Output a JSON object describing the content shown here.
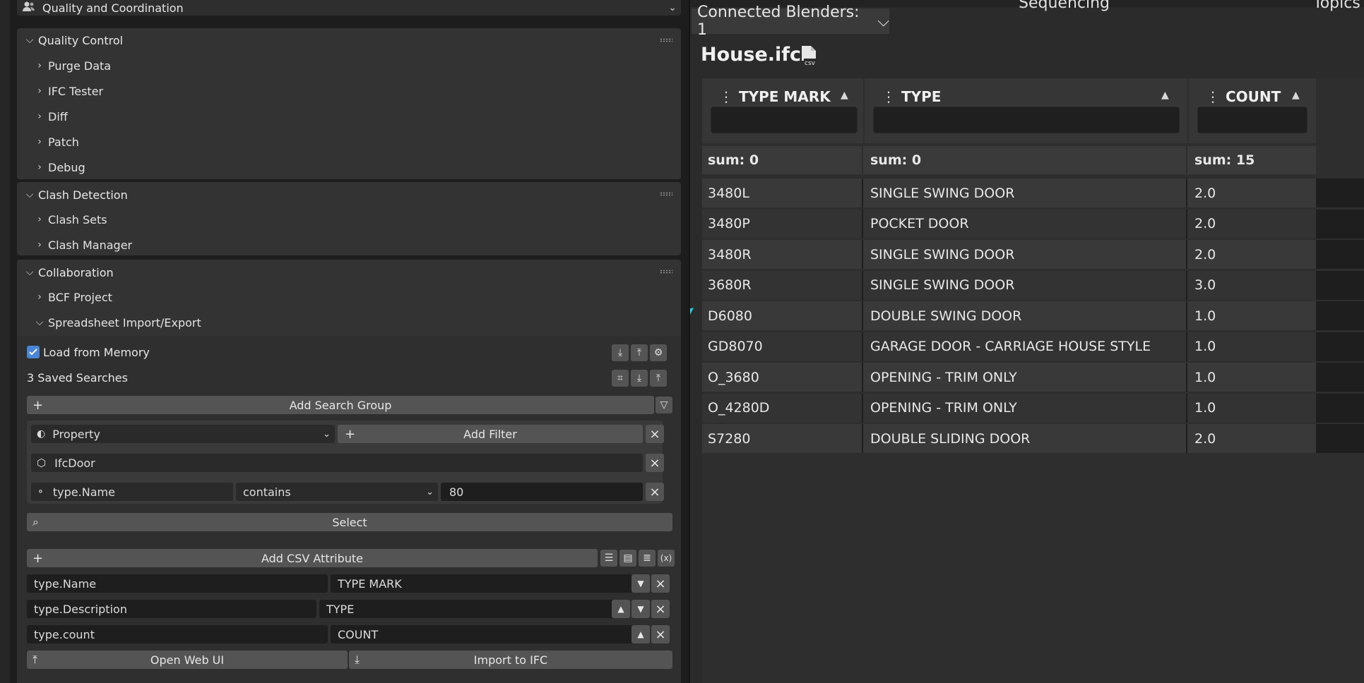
{
  "colors": {
    "accent_arrow": "#1fd6e6",
    "checkbox": "#4a86d8",
    "panel_bg": "#333333",
    "web_bg": "#2b2b2b"
  },
  "left": {
    "top_panel": {
      "title": "Quality and Coordination",
      "icon": "users-icon"
    },
    "quality_control": {
      "title": "Quality Control",
      "items": [
        "Purge Data",
        "IFC Tester",
        "Diff",
        "Patch",
        "Debug"
      ]
    },
    "clash_detection": {
      "title": "Clash Detection",
      "items": [
        "Clash Sets",
        "Clash Manager"
      ]
    },
    "collaboration": {
      "title": "Collaboration",
      "items": [
        "BCF Project",
        "Spreadsheet Import/Export"
      ]
    },
    "spreadsheet": {
      "load_from_memory": "Load from Memory",
      "load_from_memory_checked": true,
      "saved_searches": "3 Saved Searches",
      "add_search_group": "Add Search Group",
      "filter_type": "Property",
      "add_filter": "Add Filter",
      "ifc_class": "IfcDoor",
      "filter_attr": "type.Name",
      "filter_op": "contains",
      "filter_value": "80",
      "select": "Select",
      "add_csv_attribute": "Add CSV Attribute",
      "attributes": [
        {
          "name": "type.Name",
          "header": "TYPE MARK"
        },
        {
          "name": "type.Description",
          "header": "TYPE"
        },
        {
          "name": "type.count",
          "header": "COUNT"
        }
      ],
      "open_web_ui": "Open Web UI",
      "import_to_ifc": "Import to IFC"
    }
  },
  "right": {
    "connected_blenders": "Connected Blenders: 1",
    "tabs": [
      "Sequencing",
      "Topics"
    ],
    "file_title": "House.ifc",
    "columns": [
      "TYPE MARK",
      "TYPE",
      "COUNT"
    ],
    "sums": [
      "sum: 0",
      "sum: 0",
      "sum: 15"
    ],
    "rows": [
      [
        "3480L",
        "SINGLE SWING DOOR",
        "2.0"
      ],
      [
        "3480P",
        "POCKET DOOR",
        "2.0"
      ],
      [
        "3480R",
        "SINGLE SWING DOOR",
        "2.0"
      ],
      [
        "3680R",
        "SINGLE SWING DOOR",
        "3.0"
      ],
      [
        "D6080",
        "DOUBLE SWING DOOR",
        "1.0"
      ],
      [
        "GD8070",
        "GARAGE DOOR - CARRIAGE HOUSE STYLE",
        "1.0"
      ],
      [
        "O_3680",
        "OPENING - TRIM ONLY",
        "1.0"
      ],
      [
        "O_4280D",
        "OPENING - TRIM ONLY",
        "1.0"
      ],
      [
        "S7280",
        "DOUBLE SLIDING DOOR",
        "2.0"
      ]
    ]
  }
}
